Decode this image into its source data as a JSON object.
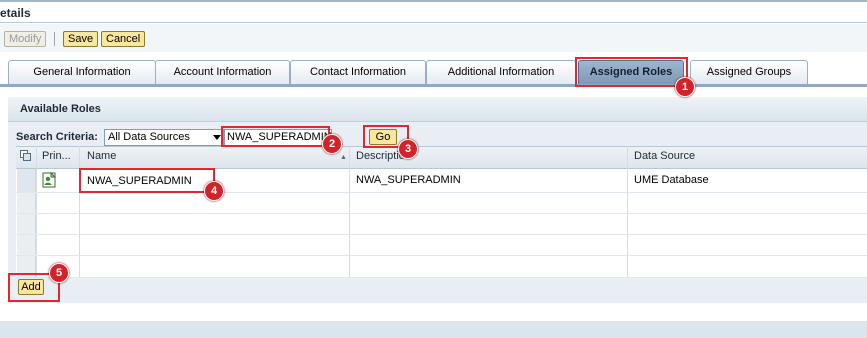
{
  "header": {
    "title": "etails"
  },
  "toolbar": {
    "modify_label": "Modify",
    "save_label": "Save",
    "cancel_label": "Cancel"
  },
  "tabs": [
    {
      "label": "General Information"
    },
    {
      "label": "Account Information"
    },
    {
      "label": "Contact Information"
    },
    {
      "label": "Additional Information"
    },
    {
      "label": "Assigned Roles",
      "active": true
    },
    {
      "label": "Assigned Groups"
    }
  ],
  "panel": {
    "title": "Available Roles"
  },
  "search": {
    "label": "Search Criteria:",
    "source_value": "All Data Sources",
    "query_value": "NWA_SUPERADMIN",
    "go_label": "Go"
  },
  "table": {
    "columns": [
      "Prin...",
      "Name",
      "Description",
      "Data Source"
    ],
    "rows": [
      {
        "name": "NWA_SUPERADMIN",
        "description": "NWA_SUPERADMIN",
        "data_source": "UME Database"
      }
    ]
  },
  "actions": {
    "add_label": "Add"
  },
  "callouts": [
    "1",
    "2",
    "3",
    "4",
    "5"
  ],
  "colors": {
    "callout": "#d2232a",
    "button": "#f8e79c",
    "active_tab": "#8fa8c2"
  }
}
